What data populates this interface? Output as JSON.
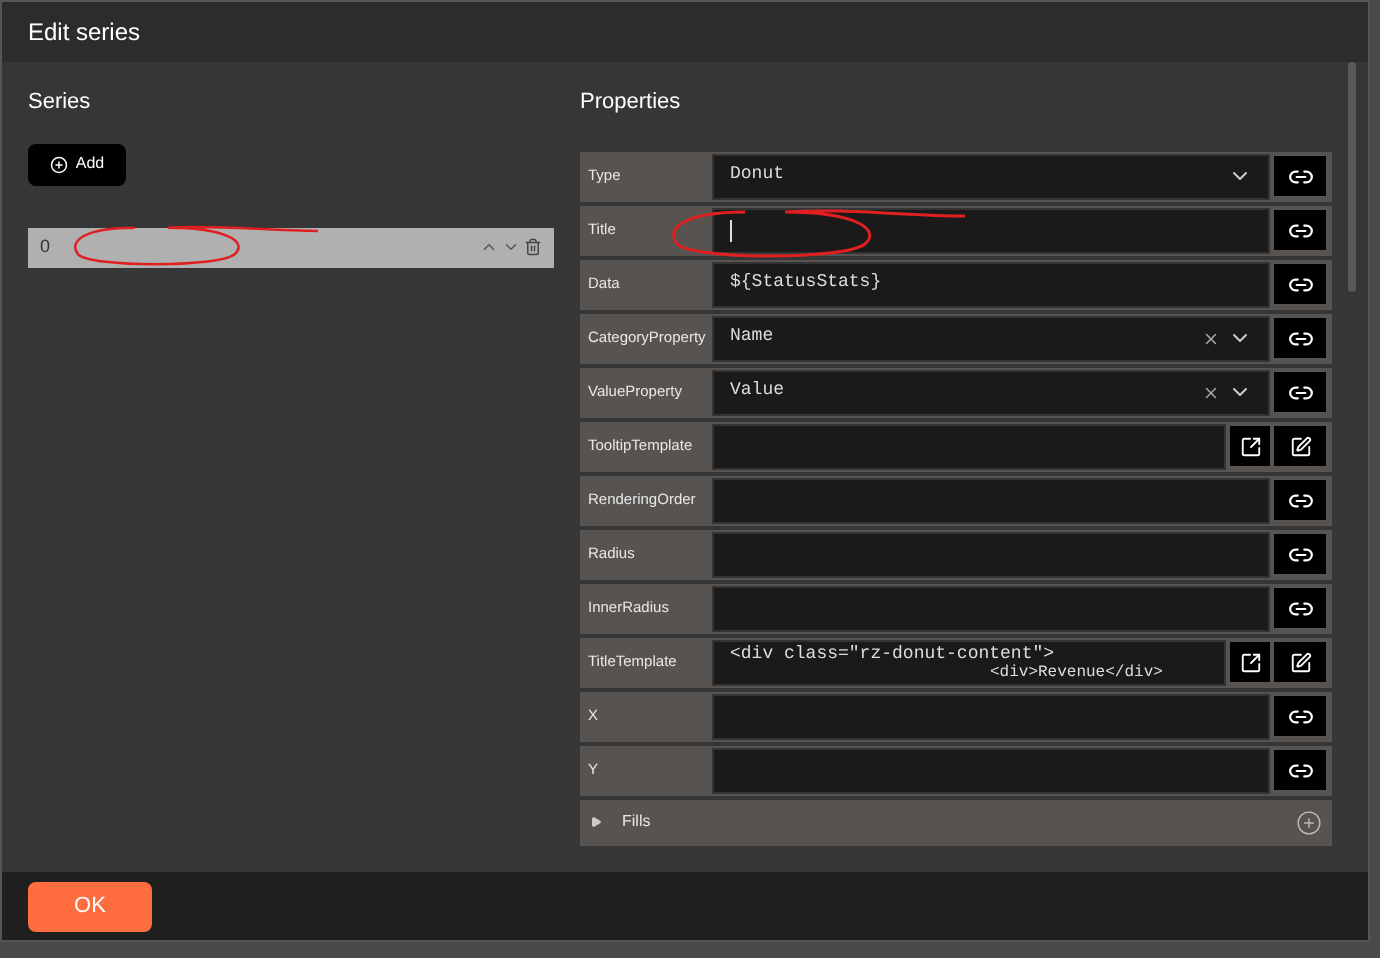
{
  "window": {
    "title": "Edit series"
  },
  "series_panel": {
    "heading": "Series",
    "add_button": "Add",
    "items": [
      {
        "label": "0",
        "selected": true
      }
    ]
  },
  "properties_panel": {
    "heading": "Properties",
    "rows": [
      {
        "label": "Type",
        "kind": "dropdown",
        "value": "Donut",
        "clearable": false
      },
      {
        "label": "Title",
        "kind": "text",
        "value": "",
        "focused": true
      },
      {
        "label": "Data",
        "kind": "text",
        "value": "${StatusStats}",
        "focused": false
      },
      {
        "label": "CategoryProperty",
        "kind": "dropdown",
        "value": "Name",
        "clearable": true
      },
      {
        "label": "ValueProperty",
        "kind": "dropdown",
        "value": "Value",
        "clearable": true
      },
      {
        "label": "TooltipTemplate",
        "kind": "template",
        "lines": []
      },
      {
        "label": "RenderingOrder",
        "kind": "text",
        "value": "",
        "focused": false
      },
      {
        "label": "Radius",
        "kind": "text",
        "value": "",
        "focused": false
      },
      {
        "label": "InnerRadius",
        "kind": "text",
        "value": "",
        "focused": false
      },
      {
        "label": "TitleTemplate",
        "kind": "template",
        "lines": [
          "<div class=\"rz-donut-content\">",
          "<div>Revenue</div>"
        ]
      },
      {
        "label": "X",
        "kind": "text",
        "value": "",
        "focused": false
      },
      {
        "label": "Y",
        "kind": "text",
        "value": "",
        "focused": false
      }
    ],
    "fills": {
      "label": "Fills",
      "expanded": false
    }
  },
  "footer": {
    "ok_button": "OK"
  }
}
